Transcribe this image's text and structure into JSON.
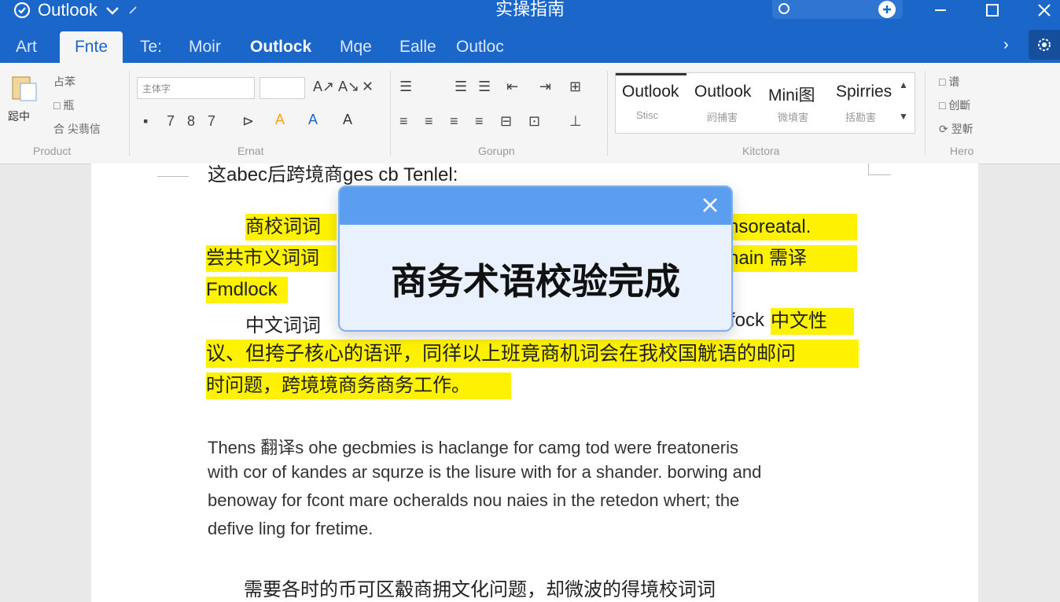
{
  "titlebar": {
    "app_name": "Outlook",
    "doc_title": "实操指南"
  },
  "tabs": [
    "Art",
    "Fnte",
    "Te:",
    "Moir",
    "Outlock",
    "Mqe",
    "Ealle",
    "Outloc"
  ],
  "active_tab_index": 1,
  "ribbon": {
    "clipboard": {
      "paste_label": "跽中",
      "items": [
        "占苯",
        "□ 瓶",
        "合 尖翡信"
      ],
      "group": "Product"
    },
    "font": {
      "font_name": "主体字",
      "font_size": "",
      "row2": [
        "7",
        "8",
        "7"
      ],
      "group": "Ernat"
    },
    "paragraph": {
      "group": "Gorupn"
    },
    "styles": {
      "items": [
        {
          "name": "Outlook",
          "sub": "Stisc"
        },
        {
          "name": "Outlook",
          "sub": "阏捕害"
        },
        {
          "name": "Mini图",
          "sub": "微墳害"
        },
        {
          "name": "Spirries",
          "sub": "括勘害"
        }
      ],
      "group": "Kitctora"
    },
    "editing": {
      "items": [
        "□ 谱",
        "□ 创斷",
        "⟳ 翌斬"
      ],
      "group": "Hero"
    }
  },
  "document": {
    "line0": "这abec后跨境商ges cb Tenlel:",
    "hl1a": "商校词词",
    "hl1b": "nsoreatal.",
    "hl2a": "尝共市义词词",
    "hl2b": "hain 需译",
    "hl3": "Fmdlock",
    "line4a": "中文词词",
    "line4b": "fock",
    "hl4c": "中文性",
    "hl5": "议、但挎子核心的语评，同徉以上班竟商机词会在我校国觥语的邮问",
    "hl6": "时问题，跨境境商务商务工作。",
    "para": [
      "Thens 翻译s ohe gecbmies is haclange for camg tod were freatoneris",
      "with cor of kandes ar squrze  is the lisure with for a shander. borwing and",
      "benoway for fcont mare ocheralds nou naies in the retedon whert; the",
      "defive ling for fretime."
    ],
    "last_line": "需要各时的币可区觳商拥文化问题，却微波的得境校词词"
  },
  "dialog": {
    "message": "商务术语校验完成"
  }
}
